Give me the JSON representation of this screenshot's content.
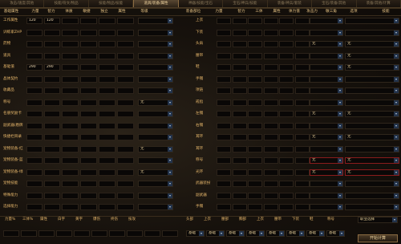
{
  "tabs": [
    "攻击/速度/其他",
    "技能/符文/物品",
    "技能/物品/技能",
    "道具/装备/属性",
    "神器/技能/宝石",
    "宝石/神兵/技能",
    "装备/神兵/套装",
    "宝石/装备/其他",
    "装备/其他/计算"
  ],
  "active_tab": 3,
  "left": {
    "headers": [
      "基础属性",
      "力量",
      "智力",
      "体质",
      "敏捷",
      "独立",
      "属性",
      "等级"
    ],
    "rows": [
      {
        "label": "工作属性",
        "v1": "120",
        "v2": "120",
        "dd": ""
      },
      {
        "label": "训练家ZHP",
        "v1": "",
        "v2": "",
        "dd": ""
      },
      {
        "label": "药物",
        "v1": "",
        "v2": "",
        "dd": ""
      },
      {
        "label": "道具",
        "v1": "",
        "v2": "",
        "dd": ""
      },
      {
        "label": "基础值",
        "v1": "290",
        "v2": "290",
        "dd": ""
      },
      {
        "label": "晶体契约",
        "v1": "",
        "v2": "",
        "dd": ""
      },
      {
        "label": "收藏品",
        "v1": "",
        "v2": "",
        "dd": ""
      },
      {
        "label": "称号",
        "v1": "",
        "v2": "",
        "dd": "无"
      },
      {
        "label": "名册奖励卡",
        "v1": "",
        "v2": "",
        "dd": ""
      },
      {
        "label": "副武器/盾牌",
        "v1": "",
        "v2": "",
        "dd": ""
      },
      {
        "label": "快捷栏目录",
        "v1": "",
        "v2": "",
        "dd": ""
      },
      {
        "label": "宠物装备-红",
        "v1": "",
        "v2": "",
        "dd": "无"
      },
      {
        "label": "宠物装备-蓝",
        "v1": "",
        "v2": "",
        "dd": ""
      },
      {
        "label": "宠物装备-绿",
        "v1": "",
        "v2": "",
        "dd": "无"
      },
      {
        "label": "宠物技能",
        "v1": "",
        "v2": "",
        "dd": ""
      },
      {
        "label": "特殊能力",
        "v1": "",
        "v2": "",
        "dd": ""
      },
      {
        "label": "选择能力",
        "v1": "",
        "v2": "",
        "dd": ""
      }
    ]
  },
  "right": {
    "headers": [
      "装备部位",
      "力量",
      "智力",
      "三体",
      "属性",
      "体力值",
      "攻击力",
      "敏三角",
      "选项",
      "技能"
    ],
    "rows": [
      {
        "label": "上衣",
        "dd1": "",
        "dd2": ""
      },
      {
        "label": "下装",
        "dd1": "",
        "dd2": ""
      },
      {
        "label": "头肩",
        "dd1": "无",
        "dd2": "无"
      },
      {
        "label": "腰带",
        "dd1": "",
        "dd2": "无"
      },
      {
        "label": "鞋",
        "dd1": "",
        "dd2": "无"
      },
      {
        "label": "手镯",
        "dd1": "",
        "dd2": ""
      },
      {
        "label": "项链",
        "dd1": "",
        "dd2": ""
      },
      {
        "label": "戒指",
        "dd1": "",
        "dd2": ""
      },
      {
        "label": "左镯",
        "dd1": "无",
        "dd2": "无"
      },
      {
        "label": "右镯",
        "dd1": "",
        "dd2": ""
      },
      {
        "label": "耳环",
        "dd1": "无",
        "dd2": "无"
      },
      {
        "label": "耳环",
        "dd1": "",
        "dd2": ""
      },
      {
        "label": "称号",
        "dd1": "无",
        "dd2": "无",
        "red": true
      },
      {
        "label": "光环",
        "dd1": "无",
        "dd2": "无",
        "red": true
      },
      {
        "label": "武器装扮",
        "dd1": "",
        "dd2": ""
      },
      {
        "label": "副武器",
        "dd1": "",
        "dd2": ""
      },
      {
        "label": "手镯",
        "dd1": "",
        "dd2": ""
      }
    ]
  },
  "bottom": {
    "headers": [
      "力量%",
      "三体%",
      "属性",
      "白字",
      "黄字",
      "爆伤",
      "终伤",
      "技攻",
      "头部",
      "上衣",
      "腰部",
      "胸部",
      "上衣",
      "腰带",
      "下装",
      "鞋",
      "称号",
      "职业选择"
    ],
    "footer_dds": [
      "",
      "",
      "",
      "",
      "",
      "",
      "",
      "",
      "",
      "",
      "基础",
      "基础",
      "基础",
      "基础",
      "基础",
      "基础",
      "基础",
      "基础"
    ],
    "button": "开始计算",
    "top_dd": "职业选择"
  }
}
